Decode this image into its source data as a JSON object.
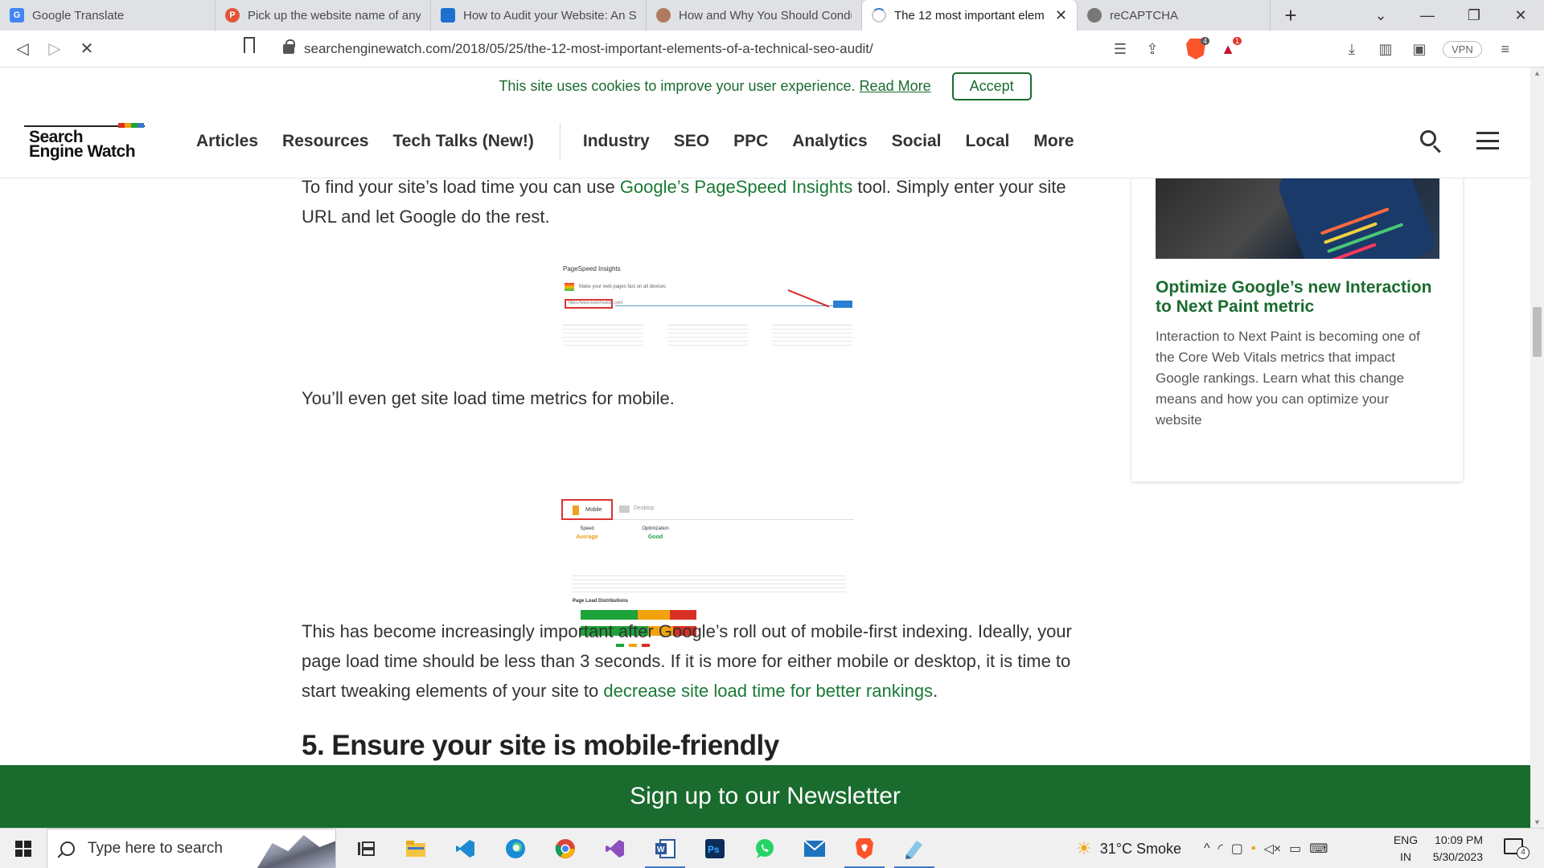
{
  "browser": {
    "tabs": [
      {
        "title": "Google Translate",
        "icon": "google-translate-icon",
        "color": "#4285f4"
      },
      {
        "title": "Pick up the website name of any",
        "icon": "brave-shield-icon",
        "color": "#e2543a"
      },
      {
        "title": "How to Audit your Website: An S",
        "icon": "site-favicon-icon",
        "color": "#1f6fd0"
      },
      {
        "title": "How and Why You Should Condu",
        "icon": "avatar-favicon-icon",
        "color": "#b07a60"
      },
      {
        "title": "The 12 most important elem",
        "icon": "loading-spinner-icon",
        "color": "#cccccc"
      },
      {
        "title": "reCAPTCHA",
        "icon": "recaptcha-icon",
        "color": "#777777"
      }
    ],
    "url": "searchenginewatch.com/2018/05/25/the-12-most-important-elements-of-a-technical-seo-audit/",
    "badges": {
      "shields": "4",
      "rewards": "1"
    },
    "vpn_label": "VPN"
  },
  "site": {
    "cookie_text": "This site uses cookies to improve your user experience.",
    "cookie_link": "Read More",
    "accept_label": "Accept",
    "logo_line1": "Search",
    "logo_line2": "Engine Watch",
    "nav_primary": [
      "Articles",
      "Resources",
      "Tech Talks (New!)"
    ],
    "nav_secondary": [
      "Industry",
      "SEO",
      "PPC",
      "Analytics",
      "Social",
      "Local",
      "More"
    ],
    "accent": "#1a6b2e"
  },
  "article": {
    "p1_a": "To find your site’s load time you can use ",
    "p1_link": "Google’s PageSpeed Insights",
    "p1_b": " tool. Simply enter your site URL and let Google do the rest.",
    "img1": {
      "title": "PageSpeed Insights",
      "sub": "Make your web pages fast on all devices",
      "input": "https://www.searchwatch.com/"
    },
    "p2": "You’ll even get site load time metrics for mobile.",
    "img2": {
      "tab_mobile": "Mobile",
      "tab_desktop": "Desktop",
      "speed_label": "Speed",
      "speed_value": "Average",
      "opt_label": "Optimization",
      "opt_value": "Good",
      "section": "Page Load Distributions"
    },
    "p3_a": "This has become increasingly important after Google’s roll out of mobile-first indexing. Ideally, your page load time should be less than 3 seconds. If it is more for either mobile or desktop, it is time to start tweaking elements of your site to ",
    "p3_link": "decrease site load time for better rankings",
    "p3_b": ".",
    "heading": "5. Ensure your site is mobile-friendly"
  },
  "sidebar": {
    "title": "Optimize Google’s new Interaction to Next Paint metric",
    "desc": "Interaction to Next Paint is becoming one of the Core Web Vitals metrics that impact Google rankings. Learn what this change means and how you can optimize your website"
  },
  "newsletter": "Sign up to our Newsletter",
  "taskbar": {
    "search_placeholder": "Type here to search",
    "apps": [
      "task-view-icon",
      "file-explorer-icon",
      "vscode-icon",
      "edge-icon",
      "chrome-icon",
      "visual-studio-icon",
      "word-icon",
      "photoshop-icon",
      "whatsapp-icon",
      "mail-icon",
      "brave-icon",
      "notepad-icon"
    ],
    "weather": "31°C  Smoke",
    "lang1": "ENG",
    "lang2": "IN",
    "time": "10:09 PM",
    "date": "5/30/2023",
    "notifications": "4"
  }
}
